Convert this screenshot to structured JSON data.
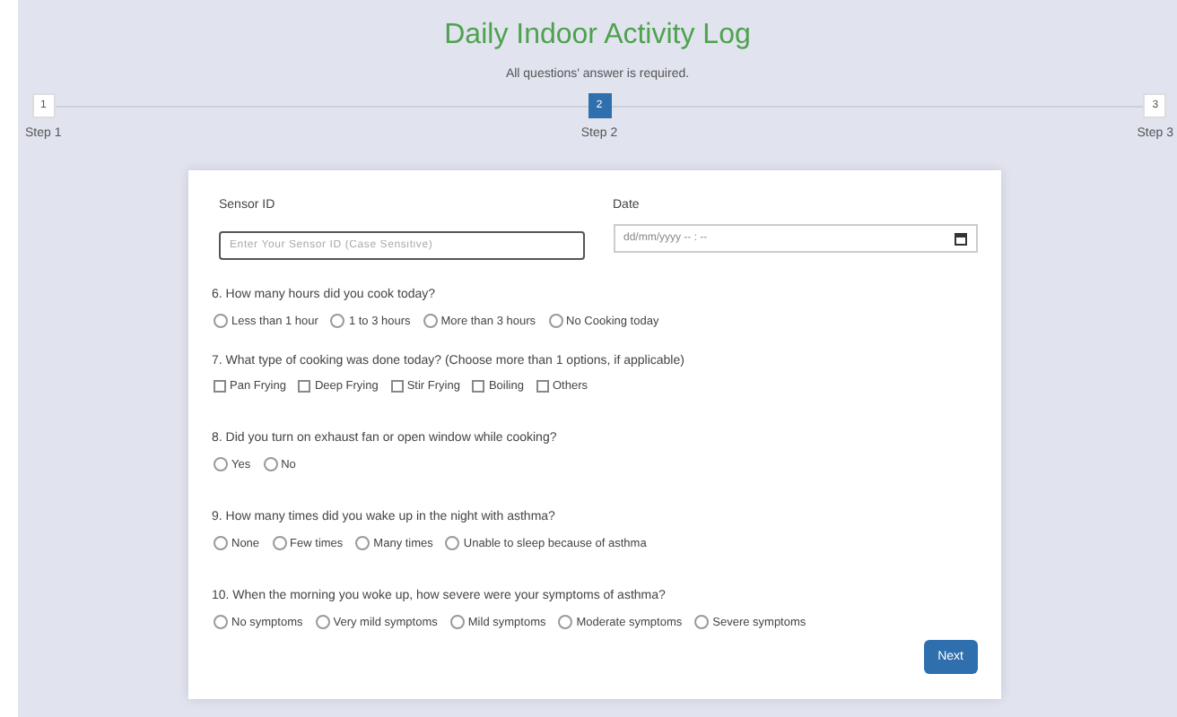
{
  "title": "Daily Indoor Activity Log",
  "subtitle": "All questions' answer is required.",
  "steps": [
    {
      "number": "1",
      "label": "Step 1",
      "selected": false
    },
    {
      "number": "2",
      "label": "Step 2",
      "selected": true
    },
    {
      "number": "3",
      "label": "Step 3",
      "selected": false
    }
  ],
  "sensor_field": {
    "label": "Sensor ID",
    "placeholder": "Enter Your Sensor ID (Case Sensitive)"
  },
  "date_field": {
    "label": "Date",
    "placeholder": "dd/mm/yyyy -- : --"
  },
  "questions": [
    {
      "text": "6. How many hours did you cook today?",
      "kind": "radio",
      "options": [
        {
          "label": "Less than 1 hour",
          "selected": false
        },
        {
          "label": "1 to 3 hours",
          "selected": false
        },
        {
          "label": "More than 3 hours",
          "selected": false
        },
        {
          "label": "No Cooking today",
          "selected": false
        }
      ]
    },
    {
      "text": "7. What type of cooking was done today? (Choose more than 1 options, if applicable)",
      "kind": "checkbox",
      "options": [
        {
          "label": "Pan Frying",
          "checked": false
        },
        {
          "label": "Deep Frying",
          "checked": false
        },
        {
          "label": "Stir Frying",
          "checked": false
        },
        {
          "label": "Boiling",
          "checked": false
        },
        {
          "label": "Others",
          "checked": false
        }
      ]
    },
    {
      "text": "8. Did you turn on exhaust fan or open window while cooking?",
      "kind": "radio",
      "options": [
        {
          "label": "Yes",
          "selected": false
        },
        {
          "label": "No",
          "selected": false
        }
      ]
    },
    {
      "text": "9. How many times did you wake up in the night with asthma?",
      "kind": "radio",
      "options": [
        {
          "label": "None",
          "selected": false
        },
        {
          "label": "Few times",
          "selected": false
        },
        {
          "label": "Many times",
          "selected": false
        },
        {
          "label": "Unable to sleep because of asthma",
          "selected": false
        }
      ]
    },
    {
      "text": "10. When the morning you woke up, how severe were your symptoms of asthma?",
      "kind": "radio",
      "options": [
        {
          "label": "No symptoms",
          "selected": false
        },
        {
          "label": "Very mild symptoms",
          "selected": false
        },
        {
          "label": "Mild symptoms",
          "selected": false
        },
        {
          "label": "Moderate symptoms",
          "selected": false
        },
        {
          "label": "Severe symptoms",
          "selected": false
        }
      ]
    }
  ],
  "next_button": "Next"
}
